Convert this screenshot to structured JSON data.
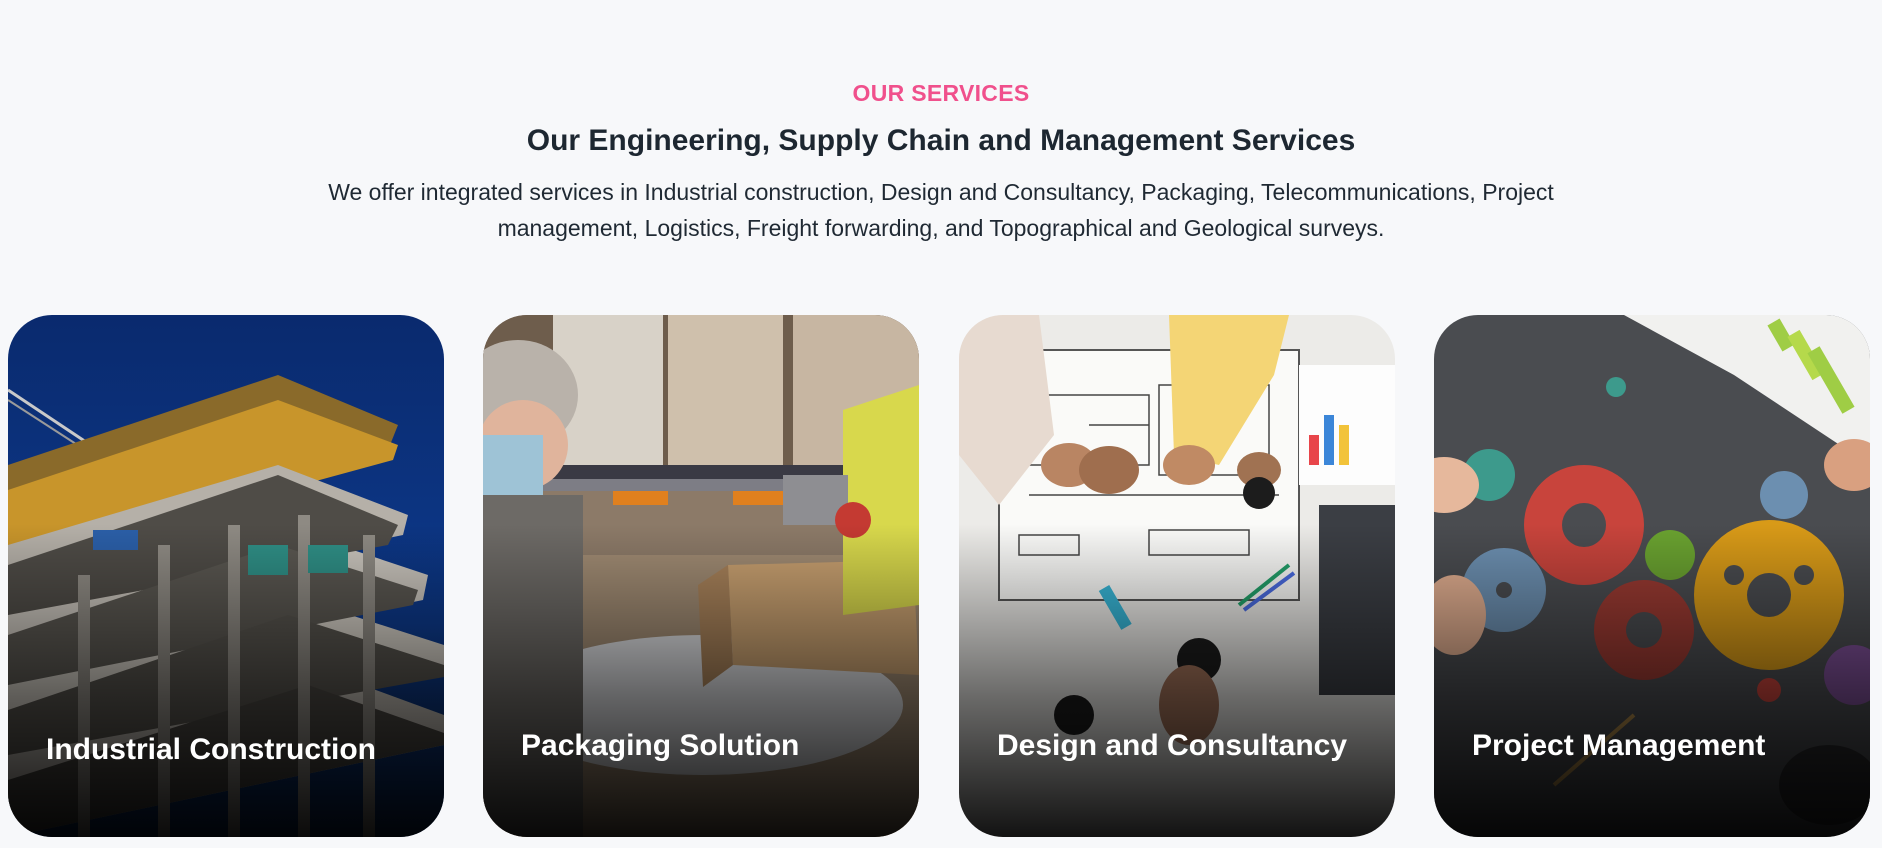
{
  "section": {
    "eyebrow": "OUR SERVICES",
    "headline": "Our Engineering, Supply Chain and Management Services",
    "description": "We offer integrated services in Industrial construction, Design and Consultancy, Packaging, Telecommunications, Project management, Logistics, Freight forwarding, and Topographical and Geological surveys."
  },
  "services": [
    {
      "title": "Industrial Construction",
      "icon": "building-under-construction-photo"
    },
    {
      "title": "Packaging Solution",
      "icon": "warehouse-packaging-photo"
    },
    {
      "title": "Design and Consultancy",
      "icon": "blueprint-design-photo"
    },
    {
      "title": "Project Management",
      "icon": "gears-teamwork-photo"
    }
  ],
  "colors": {
    "accent": "#f0508c",
    "heading": "#1d2731",
    "background": "#f7f8fa",
    "card_title": "#ffffff"
  }
}
